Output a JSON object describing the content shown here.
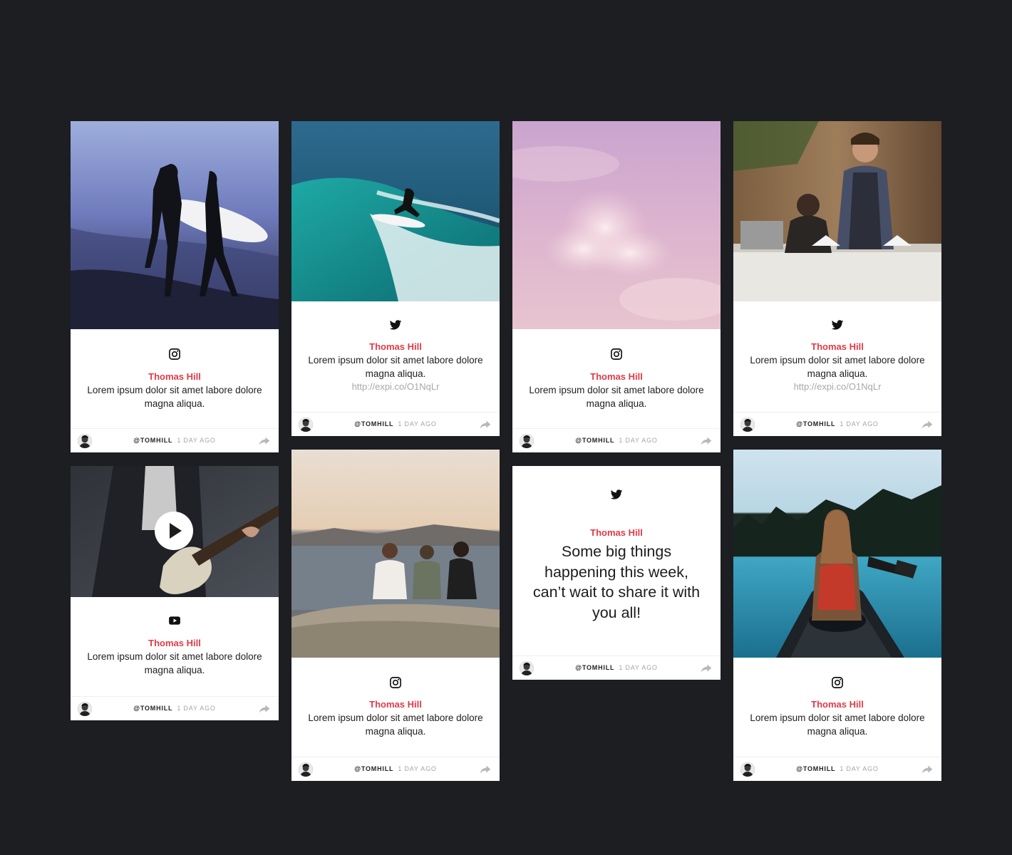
{
  "colors": {
    "background": "#1d1e22",
    "author": "#e03a48",
    "link": "#a8a8a8"
  },
  "cards": [
    {
      "network_icon": "instagram-icon",
      "author": "Thomas Hill",
      "text": "Lorem ipsum dolor sit amet labore dolore magna aliqua.",
      "handle": "@TOMHILL",
      "time": "1 DAY AGO",
      "image": "surfers-walking-beach"
    },
    {
      "network_icon": "twitter-icon",
      "author": "Thomas Hill",
      "text": "Lorem ipsum dolor sit amet labore dolore magna aliqua.",
      "link": "http://expi.co/O1NqLr",
      "handle": "@TOMHILL",
      "time": "1 DAY AGO",
      "image": "surfer-riding-wave"
    },
    {
      "network_icon": "instagram-icon",
      "author": "Thomas Hill",
      "text": "Lorem ipsum dolor sit amet labore dolore magna aliqua.",
      "handle": "@TOMHILL",
      "time": "1 DAY AGO",
      "image": "pink-clouds"
    },
    {
      "network_icon": "twitter-icon",
      "author": "Thomas Hill",
      "text": "Lorem ipsum dolor sit amet labore dolore magna aliqua.",
      "link": "http://expi.co/O1NqLr",
      "handle": "@TOMHILL",
      "time": "1 DAY AGO",
      "image": "barista-cafe"
    },
    {
      "network_icon": "youtube-icon",
      "author": "Thomas Hill",
      "text": "Lorem ipsum dolor sit amet labore dolore magna aliqua.",
      "handle": "@TOMHILL",
      "time": "1 DAY AGO",
      "image": "guitar-player-video"
    },
    {
      "network_icon": "instagram-icon",
      "author": "Thomas Hill",
      "text": "Lorem ipsum dolor sit amet labore dolore magna aliqua.",
      "handle": "@TOMHILL",
      "time": "1 DAY AGO",
      "image": "friends-overlooking-bay"
    },
    {
      "network_icon": "twitter-icon",
      "author": "Thomas Hill",
      "big_text": "Some big things happening this week, can’t wait to share it with you all!",
      "handle": "@TOMHILL",
      "time": "1 DAY AGO"
    },
    {
      "network_icon": "instagram-icon",
      "author": "Thomas Hill",
      "text": "Lorem ipsum dolor sit amet labore dolore magna aliqua.",
      "handle": "@TOMHILL",
      "time": "1 DAY AGO",
      "image": "woman-in-canoe-lake"
    }
  ]
}
